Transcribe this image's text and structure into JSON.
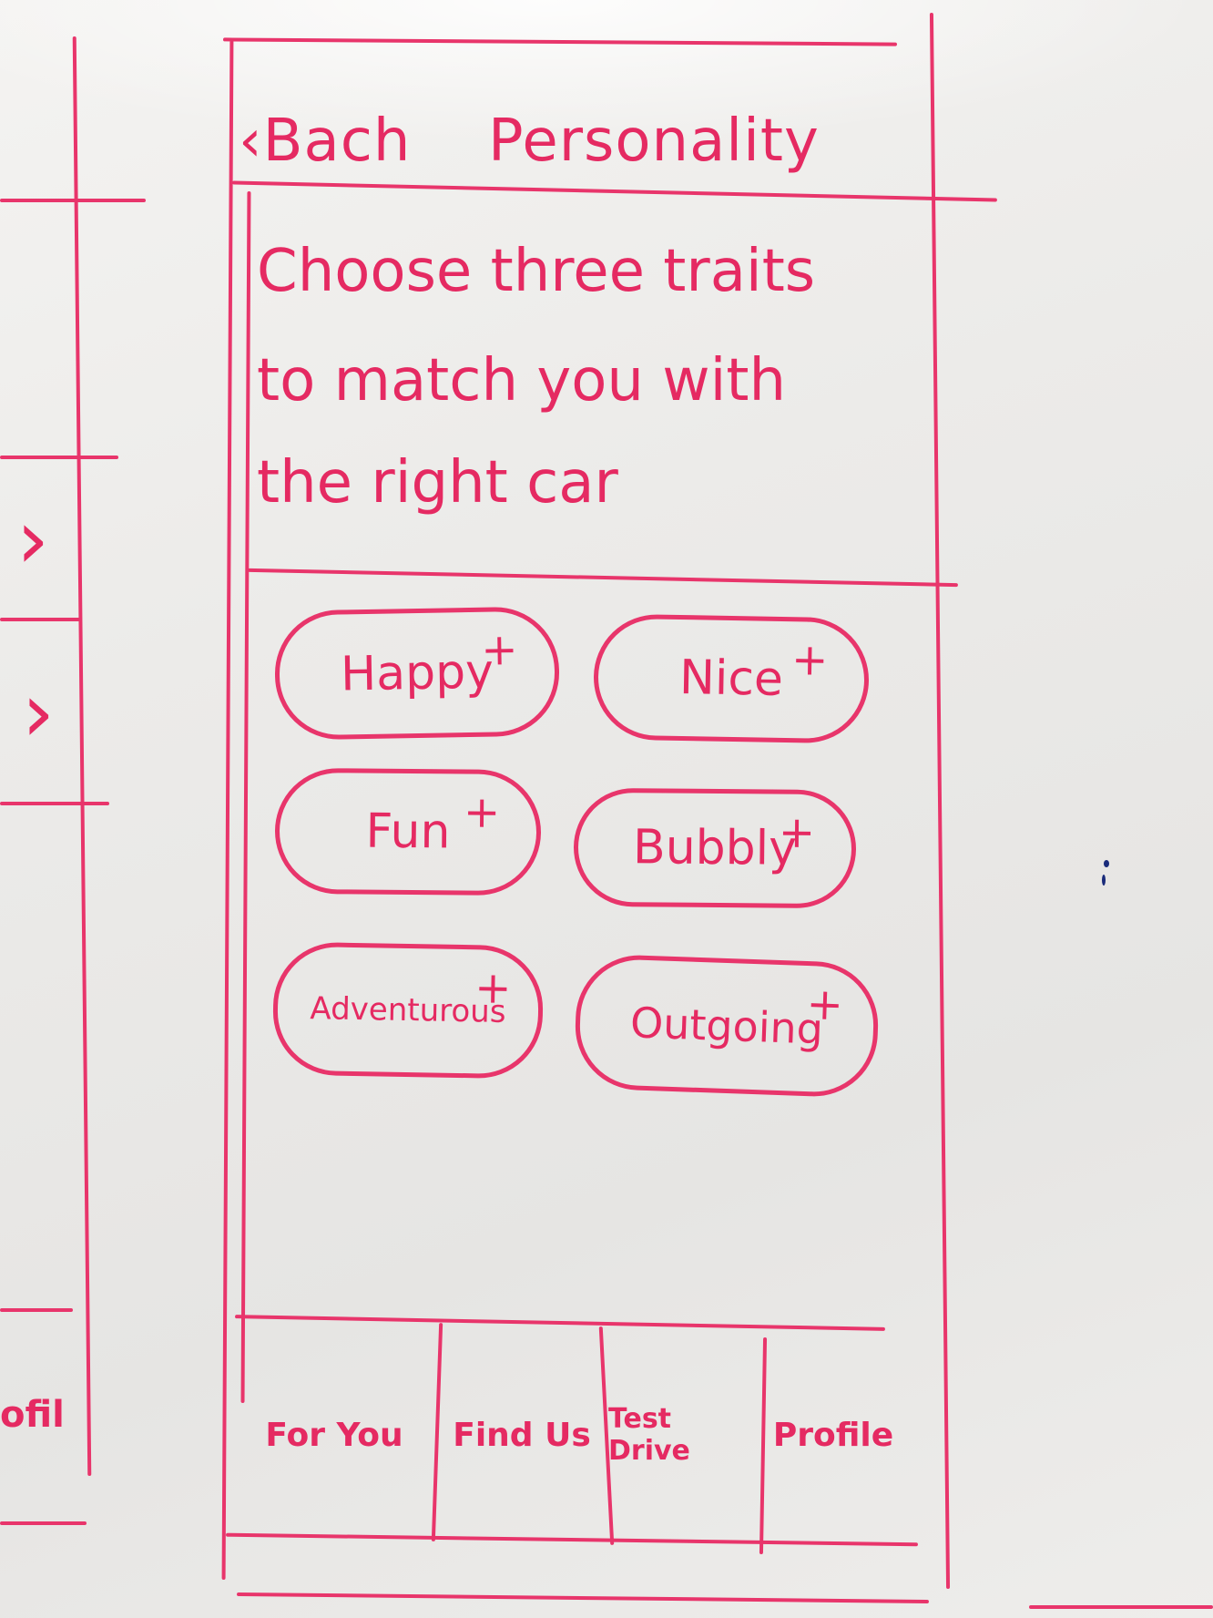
{
  "header": {
    "back_label": "‹Bach",
    "title": "Personality"
  },
  "prompt": {
    "line1": "Choose three traits",
    "line2": "to match you with",
    "line3": "the right car"
  },
  "traits": [
    {
      "label": "Happy",
      "icon": "plus-icon",
      "symbol": "+"
    },
    {
      "label": "Nice",
      "icon": "plus-icon",
      "symbol": "+"
    },
    {
      "label": "Fun",
      "icon": "plus-icon",
      "symbol": "+"
    },
    {
      "label": "Bubbly",
      "icon": "plus-icon",
      "symbol": "+"
    },
    {
      "label": "Adventurous",
      "icon": "plus-icon",
      "symbol": "+"
    },
    {
      "label": "Outgoing",
      "icon": "plus-icon",
      "symbol": "+"
    }
  ],
  "tabbar": {
    "tabs": [
      {
        "label": "For You"
      },
      {
        "label": "Find Us"
      },
      {
        "label": "Test Drive"
      },
      {
        "label": "Profile"
      }
    ]
  },
  "left_partial": {
    "bottom_label": "ofil",
    "chevron": "›"
  },
  "colors": {
    "ink": "#e8356b",
    "board": "#eeedeb"
  }
}
